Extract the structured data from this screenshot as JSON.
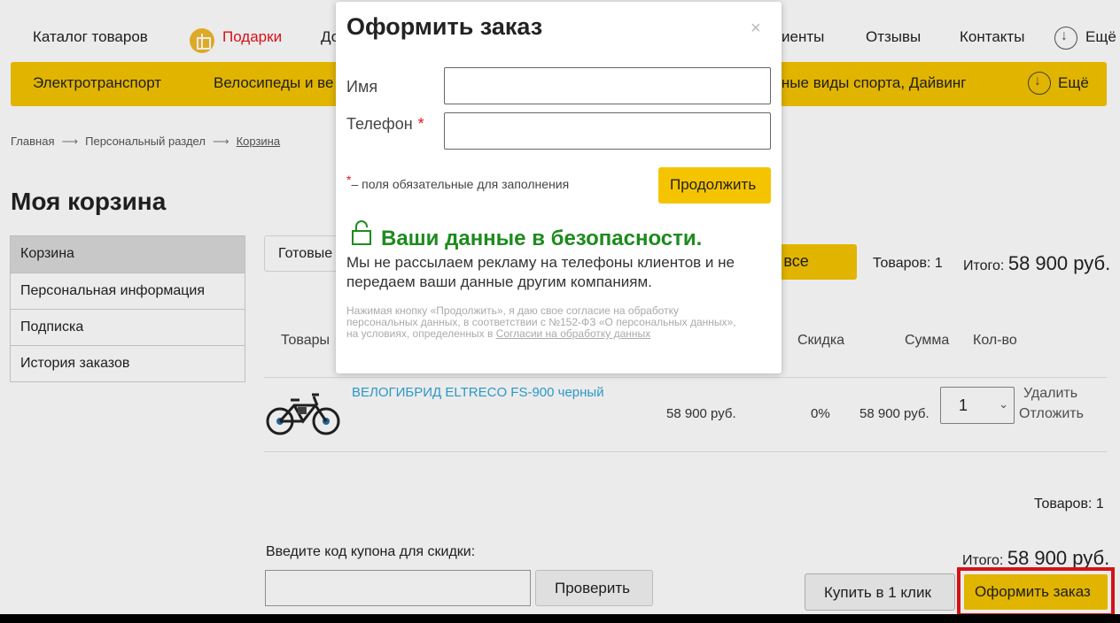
{
  "topnav": {
    "items": [
      "Каталог товаров",
      "Подарки",
      "До",
      "иенты",
      "Отзывы",
      "Контакты",
      "Ещё"
    ]
  },
  "catbar": {
    "items": [
      "Электротранспорт",
      "Велосипеды и ве",
      "дные виды спорта, Дайвинг",
      "Ещё"
    ]
  },
  "breadcrumbs": [
    "Главная",
    "Персональный раздел",
    "Корзина"
  ],
  "page_title": "Моя корзина",
  "sidemenu": [
    "Корзина",
    "Персональная информация",
    "Подписка",
    "История заказов"
  ],
  "cart": {
    "ready_tab": "Готовые",
    "buy_all_partial": "ь все",
    "count_label": "Товаров: 1",
    "total_label": "Итого:",
    "total_value": "58 900 руб.",
    "columns": [
      "Товары",
      "Скидка",
      "Сумма",
      "Кол-во"
    ],
    "product": {
      "name": "ВЕЛОГИБРИД ELTRECO FS-900 черный",
      "price": "58 900 руб.",
      "discount": "0%",
      "sum": "58 900 руб.",
      "qty": "1",
      "delete": "Удалить",
      "postpone": "Отложить"
    },
    "coupon_label": "Введите код купона для скидки:",
    "check_button": "Проверить",
    "one_click_button": "Купить в 1 клик",
    "order_button": "Оформить заказ"
  },
  "modal": {
    "title": "Оформить заказ",
    "close": "×",
    "name_label": "Имя",
    "phone_label": "Телефон",
    "required_mark": "*",
    "required_note": "– поля обязательные для заполнения",
    "continue_button": "Продолжить",
    "safe_title": "Ваши данные в безопасности.",
    "safe_text": "Мы не рассылаем рекламу на телефоны клиентов и не передаем ваши данные другим компаниям.",
    "consent_text": "Нажимая кнопку «Продолжить», я даю свое согласие на обработку персональных данных, в соответствии с №152-ФЗ «О персональных данных», на условиях, определенных в ",
    "consent_link": "Согласии на обработку данных"
  },
  "colors": {
    "accent_yellow": "#f5c400",
    "highlight_red": "#e8141a",
    "safe_green": "#1e8b1e",
    "link_blue": "#2ea7d8"
  }
}
